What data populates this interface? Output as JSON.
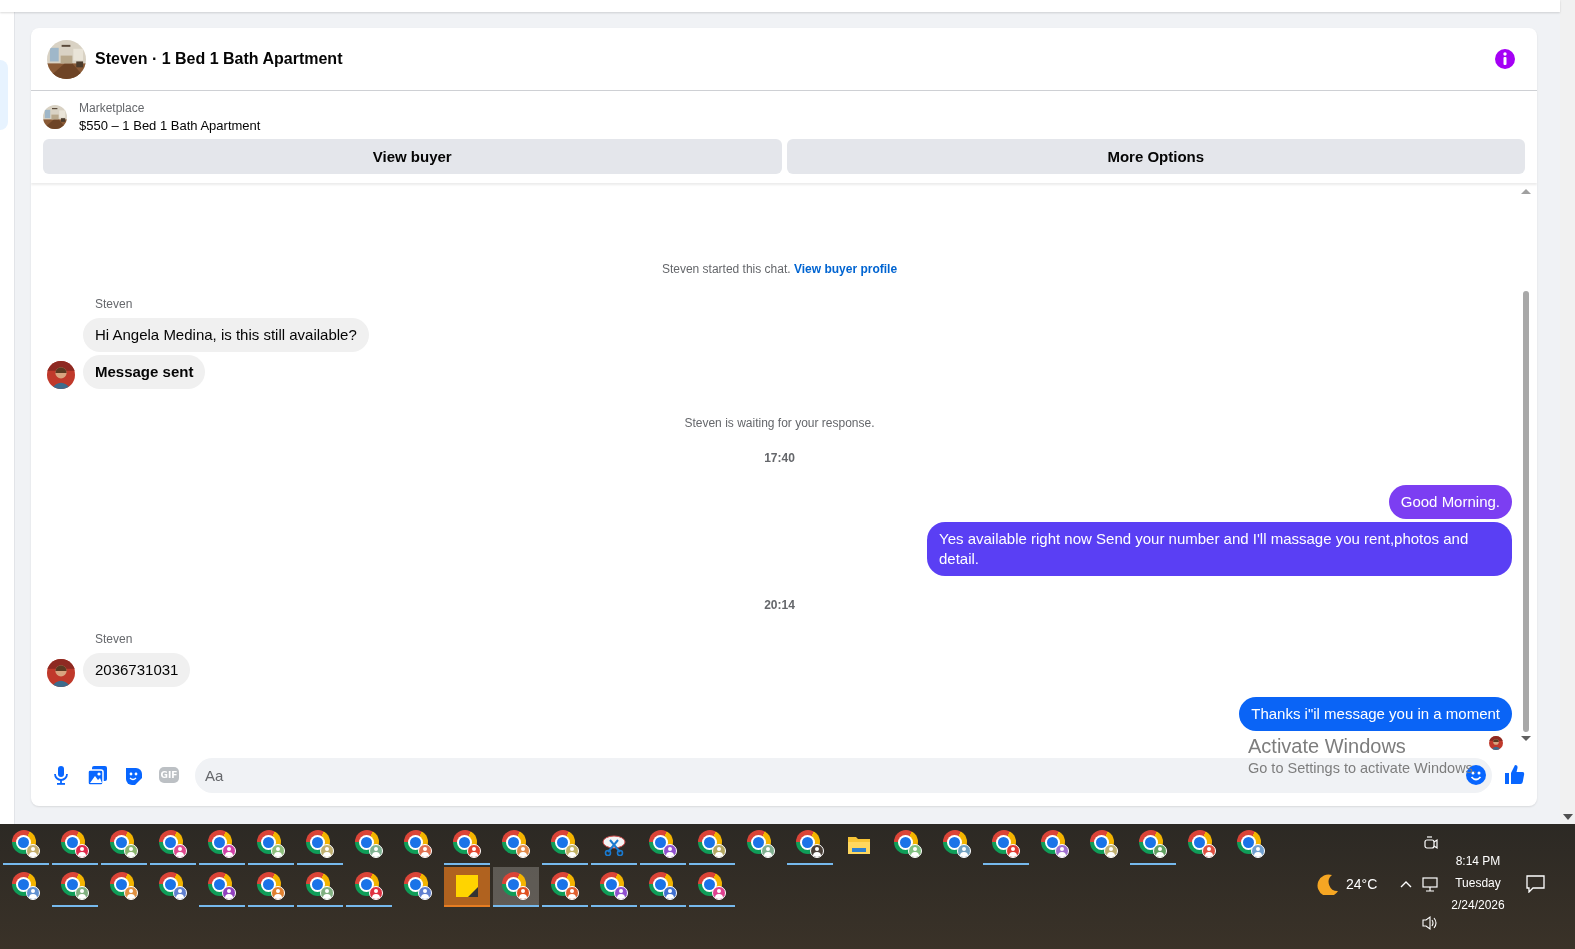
{
  "conversation": {
    "title": "Steven · 1 Bed 1 Bath Apartment"
  },
  "listing": {
    "source": "Marketplace",
    "title": "$550 – 1 Bed 1 Bath Apartment",
    "buttons": [
      "View buyer",
      "More Options"
    ]
  },
  "messages": [
    {
      "kind": "notice",
      "text": "Steven started this chat.",
      "link": "View buyer profile"
    },
    {
      "kind": "incoming",
      "sender": "Steven",
      "seen": false,
      "bubbles": [
        {
          "text": "Hi Angela Medina, is this still available?",
          "bold": false,
          "color": "#f0f0f0"
        },
        {
          "text": "Message sent",
          "bold": true,
          "color": "#f0f0f0"
        }
      ]
    },
    {
      "kind": "notice",
      "text": "Steven is waiting for your response."
    },
    {
      "kind": "time",
      "text": "17:40"
    },
    {
      "kind": "outgoing",
      "seen": false,
      "bubbles": [
        {
          "text": "Good Morning.",
          "bold": false,
          "color": "#7c3ef2"
        },
        {
          "text": "Yes available right now Send your number and I'll massage you rent,photos and detail.",
          "bold": false,
          "color": "#5a3ff4"
        }
      ]
    },
    {
      "kind": "time",
      "text": "20:14"
    },
    {
      "kind": "incoming",
      "sender": "Steven",
      "seen": false,
      "bubbles": [
        {
          "text": "2036731031",
          "bold": false,
          "color": "#f0f0f0"
        }
      ]
    },
    {
      "kind": "outgoing",
      "seen": true,
      "bubbles": [
        {
          "text": "Thanks i\"il message you in a moment",
          "bold": false,
          "color": "#0a64f6"
        }
      ]
    }
  ],
  "composer": {
    "placeholder": "Aa",
    "gif_label": "GIF"
  },
  "os_notice": {
    "title": "Activate Windows",
    "text": "Go to Settings to activate Windows."
  },
  "taskbar": {
    "rows": [
      [
        {
          "kind": "browser",
          "color": "#c4ad6c",
          "running": true,
          "selected": false
        },
        {
          "kind": "browser",
          "color": "#e0284a",
          "running": true,
          "selected": false
        },
        {
          "kind": "browser",
          "color": "#8ab56e",
          "running": true,
          "selected": false
        },
        {
          "kind": "browser",
          "color": "#e0488e",
          "running": true,
          "selected": false
        },
        {
          "kind": "browser",
          "color": "#d040a8",
          "running": true,
          "selected": false
        },
        {
          "kind": "browser",
          "color": "#8dbf7c",
          "running": true,
          "selected": false
        },
        {
          "kind": "browser",
          "color": "#c0b070",
          "running": true,
          "selected": false
        },
        {
          "kind": "browser",
          "color": "#7fb392",
          "running": false,
          "selected": false
        },
        {
          "kind": "browser",
          "color": "#e07050",
          "running": false,
          "selected": false
        },
        {
          "kind": "browser",
          "color": "#e2452e",
          "running": true,
          "selected": false
        },
        {
          "kind": "browser",
          "color": "#e08a4a",
          "running": false,
          "selected": false
        },
        {
          "kind": "browser",
          "color": "#c2b264",
          "running": true,
          "selected": false
        },
        {
          "kind": "scissors",
          "running": true,
          "selected": false
        },
        {
          "kind": "browser",
          "color": "#9050d0",
          "running": true,
          "selected": false
        },
        {
          "kind": "browser",
          "color": "#b4a862",
          "running": true,
          "selected": false
        },
        {
          "kind": "browser",
          "color": "#80b090",
          "running": false,
          "selected": false
        },
        {
          "kind": "browser",
          "color": "#4a4038",
          "running": true,
          "selected": false
        },
        {
          "kind": "folder",
          "running": false,
          "selected": false
        },
        {
          "kind": "browser",
          "color": "#80c080",
          "running": false,
          "selected": false
        },
        {
          "kind": "browser",
          "color": "#70a0c0",
          "running": false,
          "selected": false
        },
        {
          "kind": "browser",
          "color": "#e03a30",
          "running": true,
          "selected": false
        },
        {
          "kind": "browser",
          "color": "#a070d0",
          "running": false,
          "selected": false
        },
        {
          "kind": "browser",
          "color": "#c0b070",
          "running": false,
          "selected": false
        },
        {
          "kind": "browser",
          "color": "#60a060",
          "running": true,
          "selected": false
        },
        {
          "kind": "browser",
          "color": "#e05040",
          "running": false,
          "selected": false
        },
        {
          "kind": "browser",
          "color": "#70a0d0",
          "running": false,
          "selected": false
        }
      ],
      [
        {
          "kind": "browser",
          "color": "#6090d0",
          "running": false,
          "selected": false
        },
        {
          "kind": "browser",
          "color": "#80b080",
          "running": true,
          "selected": false
        },
        {
          "kind": "browser",
          "color": "#e09040",
          "running": false,
          "selected": false
        },
        {
          "kind": "browser",
          "color": "#6080d0",
          "running": false,
          "selected": false
        },
        {
          "kind": "browser",
          "color": "#9040c0",
          "running": true,
          "selected": false
        },
        {
          "kind": "browser",
          "color": "#e08030",
          "running": true,
          "selected": false
        },
        {
          "kind": "browser",
          "color": "#80b080",
          "running": true,
          "selected": false
        },
        {
          "kind": "browser",
          "color": "#e03040",
          "running": true,
          "selected": false
        },
        {
          "kind": "browser",
          "color": "#6080d0",
          "running": false,
          "selected": false
        },
        {
          "kind": "notes",
          "running": true,
          "selected": true
        },
        {
          "kind": "browser",
          "color": "#e05020",
          "running": true,
          "selected": true
        },
        {
          "kind": "browser",
          "color": "#e06030",
          "running": true,
          "selected": false
        },
        {
          "kind": "browser",
          "color": "#9050d0",
          "running": true,
          "selected": false
        },
        {
          "kind": "browser",
          "color": "#4070d0",
          "running": true,
          "selected": false
        },
        {
          "kind": "browser",
          "color": "#e04090",
          "running": true,
          "selected": false
        }
      ]
    ],
    "weather": {
      "temperature": "24°C"
    },
    "clock": {
      "time": "8:14 PM",
      "day": "Tuesday",
      "date": "2/24/2026"
    }
  }
}
